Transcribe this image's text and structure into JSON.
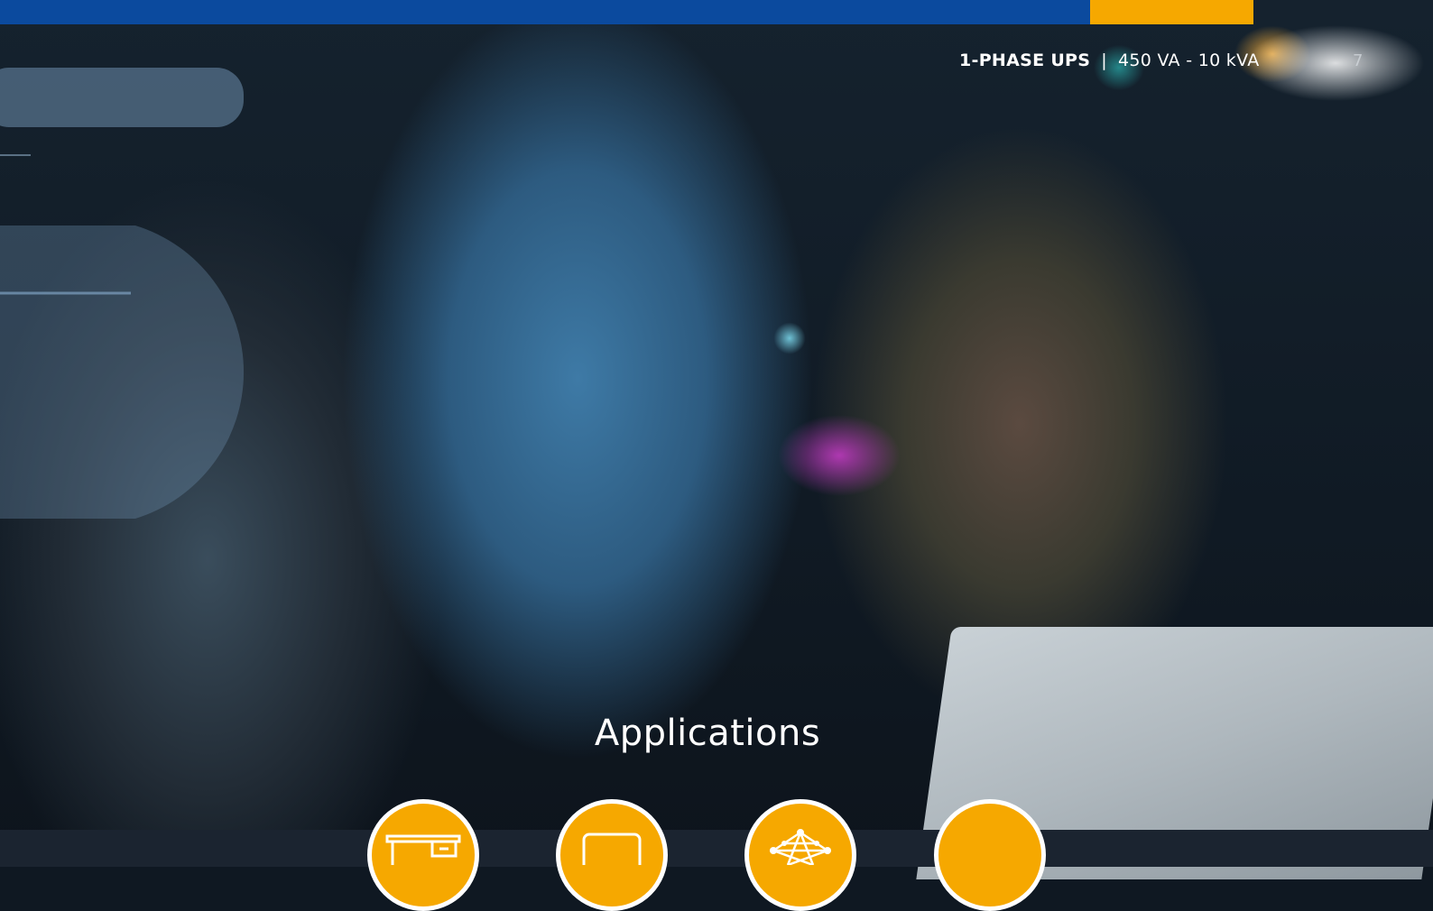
{
  "header": {
    "product_line": "1-PHASE UPS",
    "separator": "|",
    "range": "450 VA - 10 kVA",
    "page_number": "7"
  },
  "main": {
    "section_title": "Applications"
  },
  "icons": [
    "desk-icon",
    "monitor-icon",
    "network-icon",
    "blank-icon"
  ],
  "colors": {
    "brand_blue": "#0b4a9e",
    "brand_orange": "#f6a800"
  }
}
